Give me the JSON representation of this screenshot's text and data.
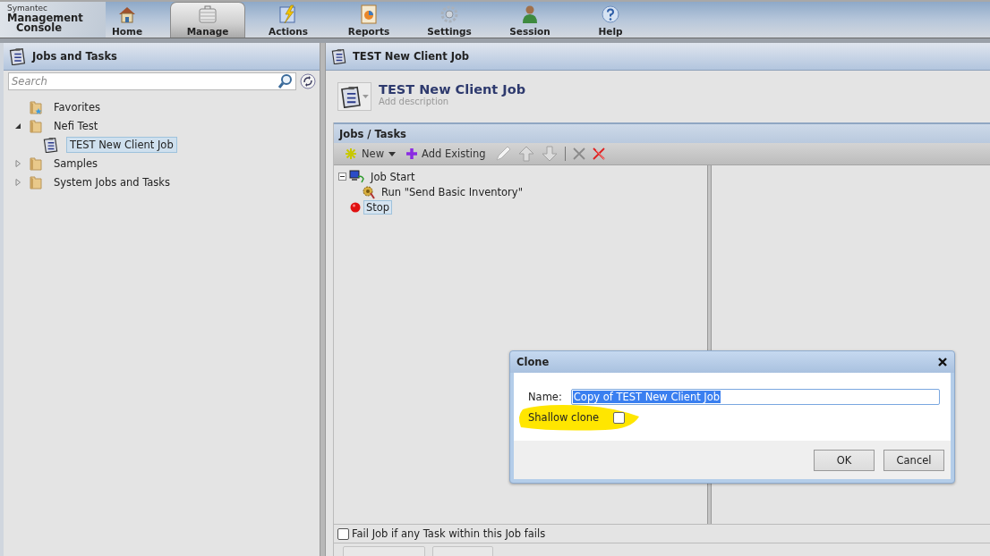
{
  "brand": {
    "vendor": "Symantec",
    "product_line1": "Management",
    "product_line2": "Console"
  },
  "nav": [
    {
      "label": "Home",
      "selected": false
    },
    {
      "label": "Manage",
      "selected": true
    },
    {
      "label": "Actions",
      "selected": false
    },
    {
      "label": "Reports",
      "selected": false
    },
    {
      "label": "Settings",
      "selected": false
    },
    {
      "label": "Session",
      "selected": false
    },
    {
      "label": "Help",
      "selected": false
    }
  ],
  "sidebar": {
    "title": "Jobs and Tasks",
    "search": {
      "placeholder": "Search"
    },
    "tree": [
      {
        "label": "Favorites",
        "kind": "favorites",
        "selected": false
      },
      {
        "label": "Nefi Test",
        "kind": "folder",
        "expanded": true,
        "selected": false,
        "children": [
          {
            "label": "TEST New Client Job",
            "kind": "job",
            "selected": true
          }
        ]
      },
      {
        "label": "Samples",
        "kind": "folder",
        "expanded": false,
        "selected": false
      },
      {
        "label": "System Jobs and Tasks",
        "kind": "folder",
        "expanded": false,
        "selected": false
      }
    ]
  },
  "main": {
    "header": "TEST New Client Job",
    "title": "TEST New Client Job",
    "description_placeholder": "Add description",
    "jobs_panel": {
      "title": "Jobs / Tasks",
      "toolbar": [
        {
          "kind": "new",
          "label": "New"
        },
        {
          "kind": "add",
          "label": "Add Existing"
        },
        {
          "kind": "edit",
          "disabled": true
        },
        {
          "kind": "up",
          "disabled": true
        },
        {
          "kind": "down",
          "disabled": true
        },
        {
          "kind": "separator"
        },
        {
          "kind": "delete",
          "disabled": true
        },
        {
          "kind": "remove",
          "disabled": false
        }
      ],
      "steps": [
        {
          "kind": "start",
          "label": "Job Start",
          "expanded": true,
          "selected": false,
          "children": [
            {
              "kind": "task",
              "label": "Run \"Send Basic Inventory\"",
              "selected": false
            }
          ]
        },
        {
          "kind": "stop",
          "label": "Stop",
          "selected": true
        }
      ],
      "fail_option": {
        "label": "Fail Job if any Task within this Job fails",
        "checked": false
      },
      "buttons": [
        {
          "kind": "button"
        },
        {
          "kind": "button"
        }
      ]
    }
  },
  "dialog": {
    "title": "Clone",
    "name_label": "Name:",
    "name_value": "Copy of TEST New Client Job",
    "name_selected": true,
    "shallow": {
      "label": "Shallow clone",
      "checked": false
    },
    "buttons": [
      "OK",
      "Cancel"
    ]
  }
}
